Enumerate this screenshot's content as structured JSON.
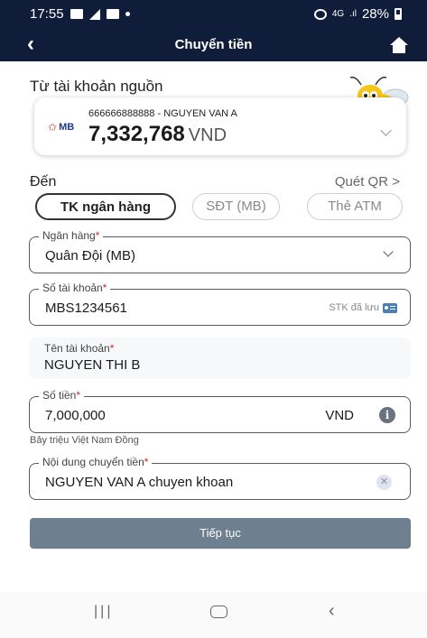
{
  "status": {
    "time": "17:55",
    "battery": "28%",
    "signal": "4G"
  },
  "header": {
    "title": "Chuyển tiền"
  },
  "source": {
    "label": "Từ tài khoản nguồn",
    "bank_logo": "MB",
    "account_line": "666666888888 - NGUYEN VAN A",
    "balance": "7,332,768",
    "currency": "VND"
  },
  "destination": {
    "label": "Đến",
    "qr_link": "Quét QR >",
    "tabs": [
      {
        "label": "TK ngân hàng",
        "active": true
      },
      {
        "label": "SĐT (MB)",
        "active": false
      },
      {
        "label": "Thẻ ATM",
        "active": false
      }
    ]
  },
  "form": {
    "bank": {
      "label": "Ngân hàng",
      "value": "Quân Đội (MB)"
    },
    "account_no": {
      "label": "Số tài khoản",
      "value": "MBS1234561",
      "saved_label": "STK đã lưu"
    },
    "account_name": {
      "label": "Tên tài khoản",
      "value": "NGUYEN THI B"
    },
    "amount": {
      "label": "Số tiền",
      "value": "7,000,000",
      "currency": "VND",
      "words": "Bảy triệu Việt Nam Đồng"
    },
    "content": {
      "label": "Nội dung chuyển tiền",
      "value": "NGUYEN VAN A chuyen khoan"
    }
  },
  "actions": {
    "continue": "Tiếp tục"
  },
  "colors": {
    "header_bg": "#0f1d3b",
    "button_bg": "#6e7f8f",
    "required": "#d7262b"
  }
}
